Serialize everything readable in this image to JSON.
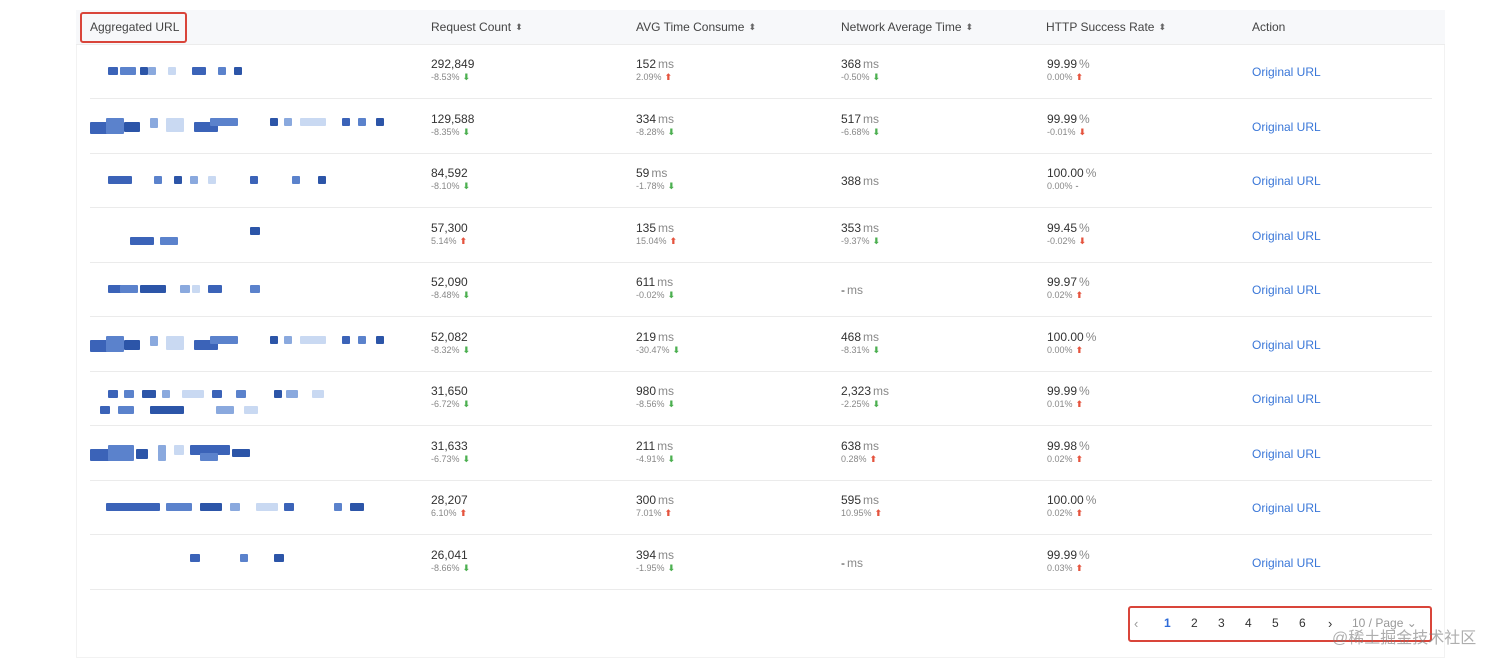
{
  "table": {
    "headers": {
      "url": "Aggregated URL",
      "request_count": "Request Count",
      "avg_time": "AVG Time Consume",
      "network_avg": "Network Average Time",
      "success_rate": "HTTP Success Rate",
      "action": "Action"
    },
    "sort_icon": "sort-icon",
    "rows": [
      {
        "count": "292,849",
        "count_d": "-8.53%",
        "count_dir": "down",
        "avg": "152",
        "avg_d": "2.09%",
        "avg_dir": "up",
        "net": "368",
        "net_d": "-0.50%",
        "net_dir": "down",
        "rate": "99.99",
        "rate_d": "0.00%",
        "rate_dir": "up",
        "action": "Original URL"
      },
      {
        "count": "129,588",
        "count_d": "-8.35%",
        "count_dir": "down",
        "avg": "334",
        "avg_d": "-8.28%",
        "avg_dir": "down",
        "net": "517",
        "net_d": "-6.68%",
        "net_dir": "down",
        "rate": "99.99",
        "rate_d": "-0.01%",
        "rate_dir": "up-red",
        "action": "Original URL"
      },
      {
        "count": "84,592",
        "count_d": "-8.10%",
        "count_dir": "down",
        "avg": "59",
        "avg_d": "-1.78%",
        "avg_dir": "down",
        "net": "388",
        "net_d": "",
        "net_dir": "none",
        "rate": "100.00",
        "rate_d": "0.00%",
        "rate_dir": "flat",
        "action": "Original URL"
      },
      {
        "count": "57,300",
        "count_d": "5.14%",
        "count_dir": "up",
        "avg": "135",
        "avg_d": "15.04%",
        "avg_dir": "up",
        "net": "353",
        "net_d": "-9.37%",
        "net_dir": "down",
        "rate": "99.45",
        "rate_d": "-0.02%",
        "rate_dir": "up-red",
        "action": "Original URL"
      },
      {
        "count": "52,090",
        "count_d": "-8.48%",
        "count_dir": "down",
        "avg": "611",
        "avg_d": "-0.02%",
        "avg_dir": "down",
        "net": "-",
        "net_d": "",
        "net_dir": "none",
        "rate": "99.97",
        "rate_d": "0.02%",
        "rate_dir": "up",
        "action": "Original URL"
      },
      {
        "count": "52,082",
        "count_d": "-8.32%",
        "count_dir": "down",
        "avg": "219",
        "avg_d": "-30.47%",
        "avg_dir": "down",
        "net": "468",
        "net_d": "-8.31%",
        "net_dir": "down",
        "rate": "100.00",
        "rate_d": "0.00%",
        "rate_dir": "up",
        "action": "Original URL"
      },
      {
        "count": "31,650",
        "count_d": "-6.72%",
        "count_dir": "down",
        "avg": "980",
        "avg_d": "-8.56%",
        "avg_dir": "down",
        "net": "2,323",
        "net_d": "-2.25%",
        "net_dir": "down",
        "rate": "99.99",
        "rate_d": "0.01%",
        "rate_dir": "up",
        "action": "Original URL"
      },
      {
        "count": "31,633",
        "count_d": "-6.73%",
        "count_dir": "down",
        "avg": "211",
        "avg_d": "-4.91%",
        "avg_dir": "down",
        "net": "638",
        "net_d": "0.28%",
        "net_dir": "up",
        "rate": "99.98",
        "rate_d": "0.02%",
        "rate_dir": "up",
        "action": "Original URL"
      },
      {
        "count": "28,207",
        "count_d": "6.10%",
        "count_dir": "up",
        "avg": "300",
        "avg_d": "7.01%",
        "avg_dir": "up",
        "net": "595",
        "net_d": "10.95%",
        "net_dir": "up",
        "rate": "100.00",
        "rate_d": "0.02%",
        "rate_dir": "up",
        "action": "Original URL"
      },
      {
        "count": "26,041",
        "count_d": "-8.66%",
        "count_dir": "down",
        "avg": "394",
        "avg_d": "-1.95%",
        "avg_dir": "down",
        "net": "-",
        "net_d": "",
        "net_dir": "none",
        "rate": "99.99",
        "rate_d": "0.03%",
        "rate_dir": "up",
        "action": "Original URL"
      }
    ],
    "unit_ms": "ms",
    "unit_pct": "%"
  },
  "pagination": {
    "prev_icon": "chevron-left-icon",
    "pages": [
      "1",
      "2",
      "3",
      "4",
      "5",
      "6"
    ],
    "active_page": "1",
    "next_icon": "chevron-right-icon",
    "page_size": "10 / Page",
    "page_size_icon": "chevron-down-icon"
  },
  "watermark": "@稀土掘金技术社区",
  "colors": {
    "link": "#3a77d8",
    "highlight_box": "#d9453a",
    "down_arrow": "#4caf50",
    "up_arrow": "#e5533d",
    "active_page": "#2f6bd8"
  }
}
